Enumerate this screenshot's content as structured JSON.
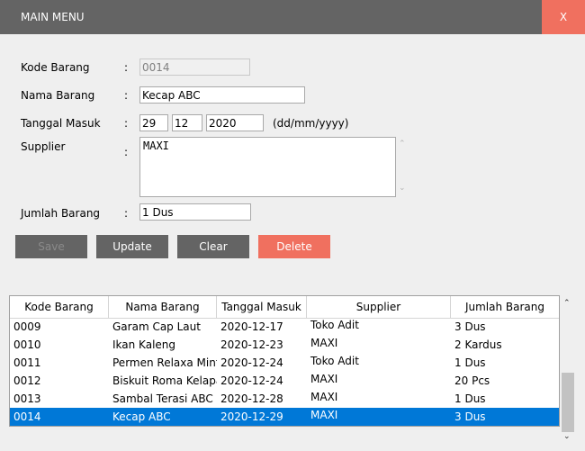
{
  "window": {
    "title": "MAIN MENU",
    "close_label": "X"
  },
  "form": {
    "kode_label": "Kode Barang",
    "kode_value": "0014",
    "nama_label": "Nama Barang",
    "nama_value": "Kecap ABC",
    "tanggal_label": "Tanggal Masuk",
    "tanggal_day": "29",
    "tanggal_month": "12",
    "tanggal_year": "2020",
    "tanggal_format": "(dd/mm/yyyy)",
    "supplier_label": "Supplier",
    "supplier_value": "MAXI",
    "jumlah_label": "Jumlah Barang",
    "jumlah_value": "1 Dus",
    "colon": ":"
  },
  "buttons": {
    "save": "Save",
    "update": "Update",
    "clear": "Clear",
    "delete": "Delete"
  },
  "colors": {
    "titlebar": "#646464",
    "accent_red": "#f0705f",
    "selection": "#0078d7"
  },
  "table": {
    "columns": [
      "Kode Barang",
      "Nama Barang",
      "Tanggal Masuk",
      "Supplier",
      "Jumlah Barang"
    ],
    "rows": [
      [
        "0009",
        "Garam Cap Laut",
        "2020-12-17",
        "Toko Adit",
        "3 Dus"
      ],
      [
        "0010",
        "Ikan Kaleng",
        "2020-12-23",
        "MAXI",
        "2 Kardus"
      ],
      [
        "0011",
        "Permen Relaxa Mint",
        "2020-12-24",
        "Toko Adit",
        "1 Dus"
      ],
      [
        "0012",
        "Biskuit Roma Kelapa",
        "2020-12-24",
        "MAXI",
        "20 Pcs"
      ],
      [
        "0013",
        "Sambal Terasi ABC",
        "2020-12-28",
        "MAXI",
        "1 Dus"
      ],
      [
        "0014",
        "Kecap ABC",
        "2020-12-29",
        "MAXI",
        "3 Dus"
      ]
    ],
    "selected_row": 5
  },
  "icons": {
    "scroll_up": "chevron-up-icon",
    "scroll_down": "chevron-down-icon"
  }
}
